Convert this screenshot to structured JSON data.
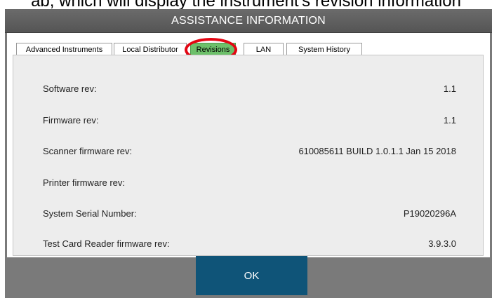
{
  "caption": "ab, which will display the instrument's revision information",
  "window": {
    "title": "ASSISTANCE INFORMATION"
  },
  "tabs": [
    {
      "label": "Advanced Instruments",
      "active": false
    },
    {
      "label": "Local Distributor",
      "active": false
    },
    {
      "label": "Revisions",
      "active": true
    },
    {
      "label": "LAN",
      "active": false
    },
    {
      "label": "System History",
      "active": false
    }
  ],
  "revisions": [
    {
      "label": "Software rev:",
      "value": "1.1"
    },
    {
      "label": "Firmware rev:",
      "value": "1.1"
    },
    {
      "label": "Scanner firmware rev:",
      "value": "610085611 BUILD 1.0.1.1 Jan 15 2018"
    },
    {
      "label": "Printer firmware rev:",
      "value": ""
    },
    {
      "label": "System Serial Number:",
      "value": "P19020296A"
    },
    {
      "label": "Test Card Reader firmware rev:",
      "value": "3.9.3.0"
    }
  ],
  "ok_label": "OK",
  "colors": {
    "active_tab": "#6dc06a",
    "ok_button": "#0f5478",
    "highlight_ring": "#e30613"
  }
}
